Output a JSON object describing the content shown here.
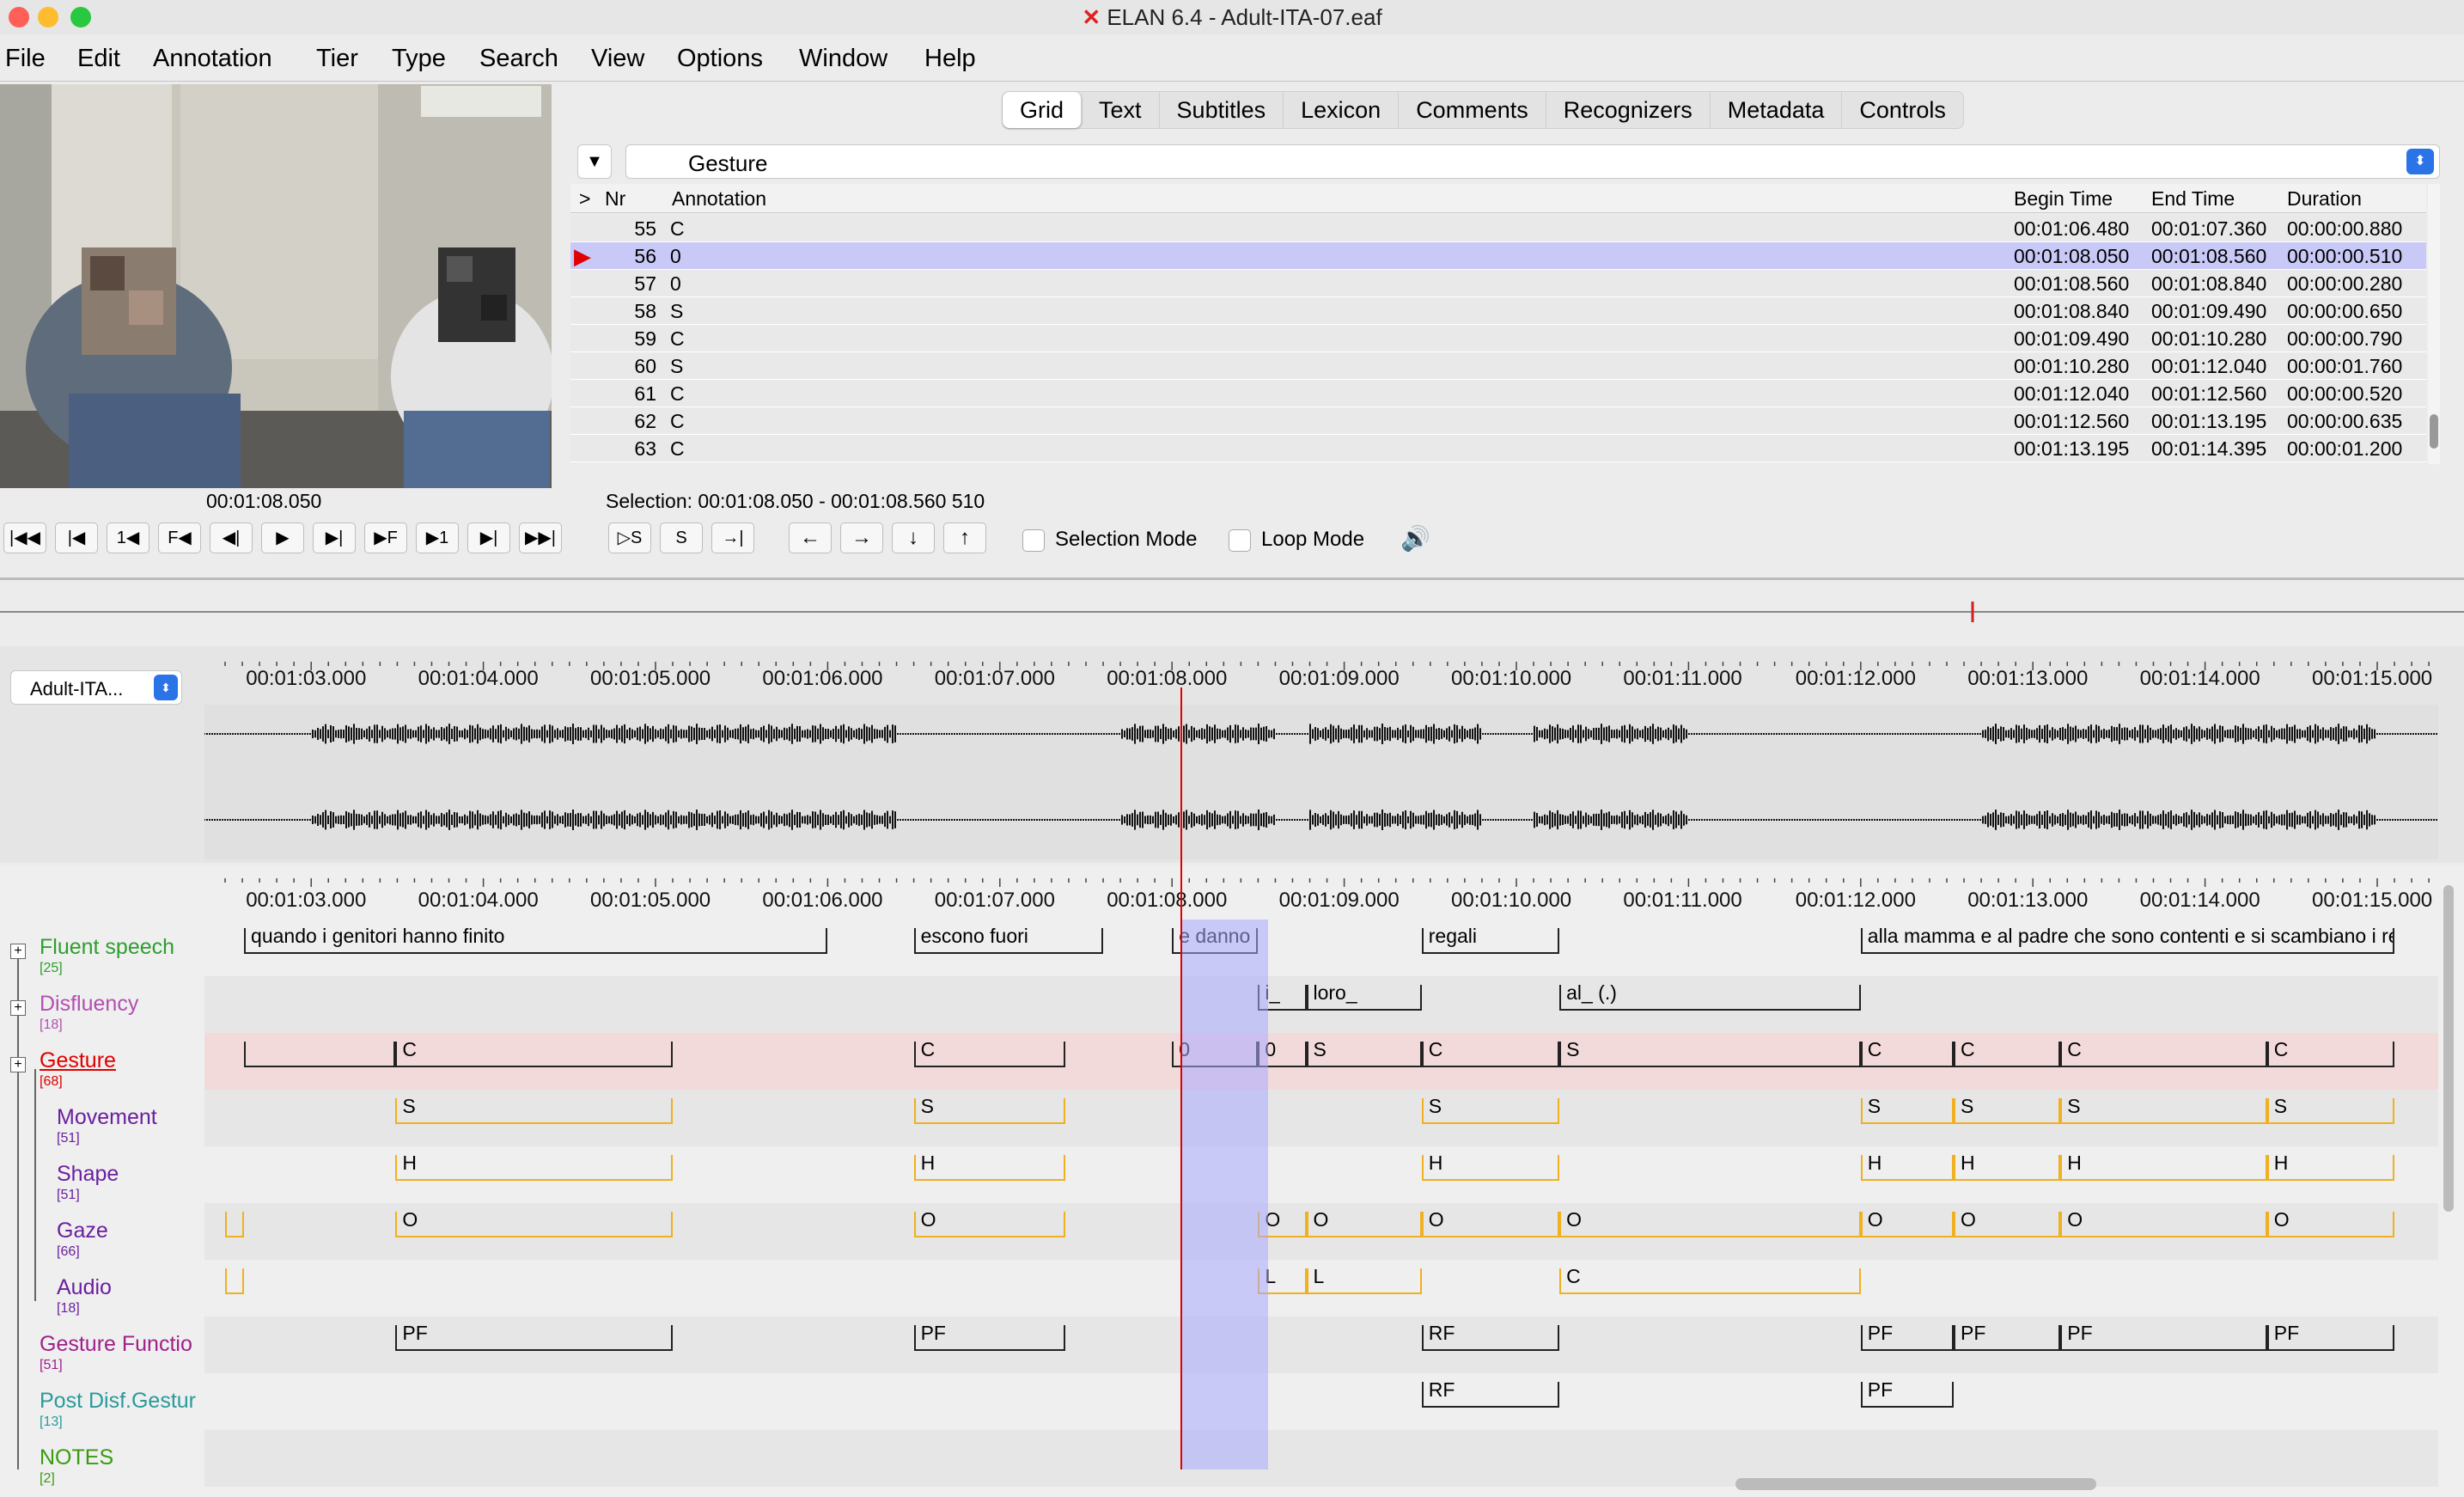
{
  "window": {
    "title": "ELAN 6.4 - Adult-ITA-07.eaf"
  },
  "menu": [
    "File",
    "Edit",
    "Annotation",
    "Tier",
    "Type",
    "Search",
    "View",
    "Options",
    "Window",
    "Help"
  ],
  "tabs": [
    "Grid",
    "Text",
    "Subtitles",
    "Lexicon",
    "Comments",
    "Recognizers",
    "Metadata",
    "Controls"
  ],
  "grid": {
    "tier": "Gesture",
    "columns": {
      "arrow": ">",
      "nr": "Nr",
      "annotation": "Annotation",
      "begin": "Begin Time",
      "end": "End Time",
      "duration": "Duration"
    },
    "rows": [
      {
        "nr": "55",
        "ann": "C",
        "begin": "00:01:06.480",
        "end": "00:01:07.360",
        "dur": "00:00:00.880"
      },
      {
        "nr": "56",
        "ann": "0",
        "begin": "00:01:08.050",
        "end": "00:01:08.560",
        "dur": "00:00:00.510"
      },
      {
        "nr": "57",
        "ann": "0",
        "begin": "00:01:08.560",
        "end": "00:01:08.840",
        "dur": "00:00:00.280"
      },
      {
        "nr": "58",
        "ann": "S",
        "begin": "00:01:08.840",
        "end": "00:01:09.490",
        "dur": "00:00:00.650"
      },
      {
        "nr": "59",
        "ann": "C",
        "begin": "00:01:09.490",
        "end": "00:01:10.280",
        "dur": "00:00:00.790"
      },
      {
        "nr": "60",
        "ann": "S",
        "begin": "00:01:10.280",
        "end": "00:01:12.040",
        "dur": "00:00:01.760"
      },
      {
        "nr": "61",
        "ann": "C",
        "begin": "00:01:12.040",
        "end": "00:01:12.560",
        "dur": "00:00:00.520"
      },
      {
        "nr": "62",
        "ann": "C",
        "begin": "00:01:12.560",
        "end": "00:01:13.195",
        "dur": "00:00:00.635"
      },
      {
        "nr": "63",
        "ann": "C",
        "begin": "00:01:13.195",
        "end": "00:01:14.395",
        "dur": "00:00:01.200"
      }
    ],
    "selected_row": 1
  },
  "player": {
    "time": "00:01:08.050",
    "selection": "Selection: 00:01:08.050 - 00:01:08.560  510",
    "selection_mode": "Selection Mode",
    "loop_mode": "Loop Mode"
  },
  "transport_buttons": [
    "|◀◀",
    "|◀",
    "1◀",
    "F◀",
    "◀|",
    "▶",
    "▶|",
    "▶F",
    "▶1",
    "▶|",
    "▶▶|"
  ],
  "selection_buttons": [
    "▷S",
    "S",
    "→|"
  ],
  "nav_buttons": [
    "←",
    "→",
    "↓",
    "↑"
  ],
  "waveform": {
    "track": "Adult-ITA..."
  },
  "timeline": {
    "ticks": [
      "00:01:03.000",
      "00:01:04.000",
      "00:01:05.000",
      "00:01:06.000",
      "00:01:07.000",
      "00:01:08.000",
      "00:01:09.000",
      "00:01:10.000",
      "00:01:11.000",
      "00:01:12.000",
      "00:01:13.000",
      "00:01:14.000",
      "00:01:15.000"
    ]
  },
  "tiers": [
    {
      "name": "Fluent speech",
      "count": "[25]",
      "color": "#2e9e2e",
      "annotations": [
        {
          "t": "quando i genitori hanno finito",
          "s": 0.11,
          "e": 3.5
        },
        {
          "t": "escono fuori",
          "s": 4.0,
          "e": 5.1
        },
        {
          "t": "e danno",
          "s": 5.5,
          "e": 6.0
        },
        {
          "t": "regali",
          "s": 6.95,
          "e": 7.75
        },
        {
          "t": "alla mamma e al padre che sono contenti e si scambiano i regali",
          "s": 9.5,
          "e": 12.6
        }
      ]
    },
    {
      "name": "Disfluency",
      "count": "[18]",
      "color": "#b24fb2",
      "annotations": [
        {
          "t": "i_",
          "s": 6.0,
          "e": 6.28
        },
        {
          "t": "loro_",
          "s": 6.28,
          "e": 6.95
        },
        {
          "t": "al_ (.)",
          "s": 7.75,
          "e": 9.5
        }
      ]
    },
    {
      "name": "Gesture",
      "count": "[68]",
      "color": "#e00000",
      "annotations": [
        {
          "t": "",
          "s": 0.11,
          "e": 0.99
        },
        {
          "t": "C",
          "s": 0.99,
          "e": 2.6
        },
        {
          "t": "C",
          "s": 4.0,
          "e": 4.88
        },
        {
          "t": "0",
          "s": 5.5,
          "e": 6.0
        },
        {
          "t": "0",
          "s": 6.0,
          "e": 6.28
        },
        {
          "t": "S",
          "s": 6.28,
          "e": 6.95
        },
        {
          "t": "C",
          "s": 6.95,
          "e": 7.75
        },
        {
          "t": "S",
          "s": 7.75,
          "e": 9.5
        },
        {
          "t": "C",
          "s": 9.5,
          "e": 10.04
        },
        {
          "t": "C",
          "s": 10.04,
          "e": 10.66
        },
        {
          "t": "C",
          "s": 10.66,
          "e": 11.86
        },
        {
          "t": "C",
          "s": 11.86,
          "e": 12.6
        }
      ]
    },
    {
      "name": "Movement",
      "count": "[51]",
      "color": "#6a1fa0",
      "annotations": [
        {
          "t": "S",
          "s": 0.99,
          "e": 2.6
        },
        {
          "t": "S",
          "s": 4.0,
          "e": 4.88
        },
        {
          "t": "S",
          "s": 6.95,
          "e": 7.75
        },
        {
          "t": "S",
          "s": 9.5,
          "e": 10.04
        },
        {
          "t": "S",
          "s": 10.04,
          "e": 10.66
        },
        {
          "t": "S",
          "s": 10.66,
          "e": 11.86
        },
        {
          "t": "S",
          "s": 11.86,
          "e": 12.6
        }
      ]
    },
    {
      "name": "Shape",
      "count": "[51]",
      "color": "#6a1fa0",
      "annotations": [
        {
          "t": "H",
          "s": 0.99,
          "e": 2.6
        },
        {
          "t": "H",
          "s": 4.0,
          "e": 4.88
        },
        {
          "t": "H",
          "s": 6.95,
          "e": 7.75
        },
        {
          "t": "H",
          "s": 9.5,
          "e": 10.04
        },
        {
          "t": "H",
          "s": 10.04,
          "e": 10.66
        },
        {
          "t": "H",
          "s": 10.66,
          "e": 11.86
        },
        {
          "t": "H",
          "s": 11.86,
          "e": 12.6
        }
      ]
    },
    {
      "name": "Gaze",
      "count": "[66]",
      "color": "#6a1fa0",
      "annotations": [
        {
          "t": "",
          "s": 0.0,
          "e": 0.11
        },
        {
          "t": "O",
          "s": 0.99,
          "e": 2.6
        },
        {
          "t": "O",
          "s": 4.0,
          "e": 4.88
        },
        {
          "t": "O",
          "s": 6.0,
          "e": 6.28
        },
        {
          "t": "O",
          "s": 6.28,
          "e": 6.95
        },
        {
          "t": "O",
          "s": 6.95,
          "e": 7.75
        },
        {
          "t": "O",
          "s": 7.75,
          "e": 9.5
        },
        {
          "t": "O",
          "s": 9.5,
          "e": 10.04
        },
        {
          "t": "O",
          "s": 10.04,
          "e": 10.66
        },
        {
          "t": "O",
          "s": 10.66,
          "e": 11.86
        },
        {
          "t": "O",
          "s": 11.86,
          "e": 12.6
        }
      ]
    },
    {
      "name": "Audio",
      "count": "[18]",
      "color": "#6a1fa0",
      "annotations": [
        {
          "t": "",
          "s": 0.0,
          "e": 0.11
        },
        {
          "t": "L",
          "s": 6.0,
          "e": 6.28
        },
        {
          "t": "L",
          "s": 6.28,
          "e": 6.95
        },
        {
          "t": "C",
          "s": 7.75,
          "e": 9.5
        }
      ]
    },
    {
      "name": "Gesture Functio",
      "count": "[51]",
      "color": "#a0208a",
      "annotations": [
        {
          "t": "PF",
          "s": 0.99,
          "e": 2.6
        },
        {
          "t": "PF",
          "s": 4.0,
          "e": 4.88
        },
        {
          "t": "RF",
          "s": 6.95,
          "e": 7.75
        },
        {
          "t": "PF",
          "s": 9.5,
          "e": 10.04
        },
        {
          "t": "PF",
          "s": 10.04,
          "e": 10.66
        },
        {
          "t": "PF",
          "s": 10.66,
          "e": 11.86
        },
        {
          "t": "PF",
          "s": 11.86,
          "e": 12.6
        }
      ]
    },
    {
      "name": "Post Disf.Gestur",
      "count": "[13]",
      "color": "#2a9a9a",
      "annotations": [
        {
          "t": "RF",
          "s": 6.95,
          "e": 7.75
        },
        {
          "t": "PF",
          "s": 9.5,
          "e": 10.04
        }
      ]
    },
    {
      "name": "NOTES",
      "count": "[2]",
      "color": "#3a9a10",
      "annotations": []
    }
  ],
  "colors": {
    "accent": "#e00000",
    "selection": "#c9c9f7",
    "yellow": "#f0b020"
  }
}
